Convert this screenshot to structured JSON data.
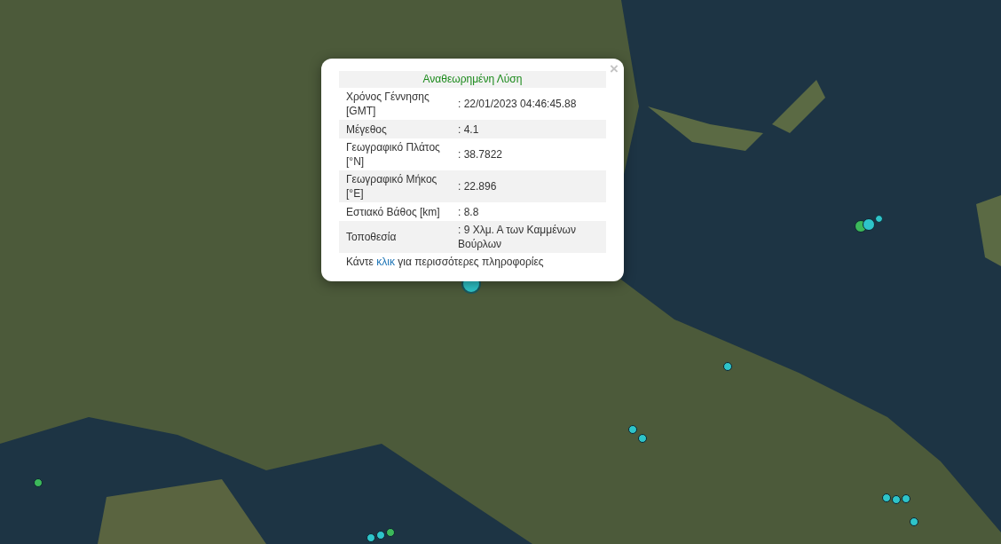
{
  "popup": {
    "close": "×",
    "title": "Αναθεωρημένη Λύση",
    "rows": [
      {
        "label": "Χρόνος Γέννησης [GMT]",
        "value": ": 22/01/2023 04:46:45.88"
      },
      {
        "label": "Μέγεθος",
        "value": ": 4.1"
      },
      {
        "label": "Γεωγραφικό Πλάτος [°N]",
        "value": ": 38.7822"
      },
      {
        "label": "Γεωγραφικό Μήκος [°E]",
        "value": ": 22.896"
      },
      {
        "label": "Εστιακό Βάθος [km]",
        "value": ": 8.8"
      },
      {
        "label": "Τοποθεσία",
        "value": ": 9 Χλμ. Α των Καμμένων Βούρλων"
      }
    ],
    "footer_before": "Κάντε",
    "footer_link": "κλικ",
    "footer_after": "για περισσότερες πληροφορίες"
  },
  "markers": [
    {
      "color": "#2ec4c9"
    },
    {
      "color": "#2ec4c9"
    },
    {
      "color": "#3cb85a"
    },
    {
      "color": "#2ec4c9"
    },
    {
      "color": "#2ec4c9"
    },
    {
      "color": "#2ec4c9"
    },
    {
      "color": "#2ec4c9"
    },
    {
      "color": "#3cb85a"
    },
    {
      "color": "#3cb85a"
    },
    {
      "color": "#2ec4c9"
    },
    {
      "color": "#2ec4c9"
    },
    {
      "color": "#2ec4c9"
    },
    {
      "color": "#2ec4c9"
    },
    {
      "color": "#2ec4c9"
    },
    {
      "color": "#2ec4c9"
    }
  ]
}
